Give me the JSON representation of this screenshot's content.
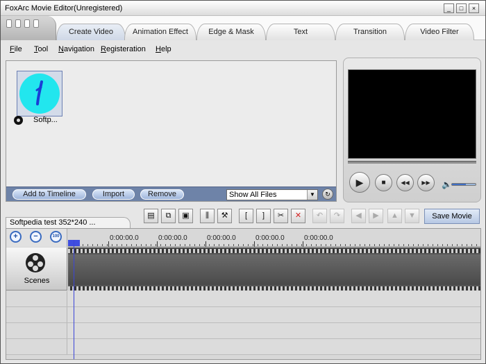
{
  "window": {
    "title": "FoxArc Movie Editor(Unregistered)",
    "minimize": "_",
    "maximize": "□",
    "close": "×"
  },
  "tabs": [
    {
      "label": "Create Video",
      "active": true
    },
    {
      "label": "Animation Effect",
      "active": false
    },
    {
      "label": "Edge & Mask",
      "active": false
    },
    {
      "label": "Text",
      "active": false
    },
    {
      "label": "Transition",
      "active": false
    },
    {
      "label": "Video Filter",
      "active": false
    }
  ],
  "menu": {
    "file": {
      "ul": "F",
      "rest": "ile"
    },
    "tool": {
      "ul": "T",
      "rest": "ool"
    },
    "navigation": {
      "ul": "N",
      "rest": "avigation"
    },
    "registeration": {
      "ul": "R",
      "rest": "egisteration"
    },
    "help": {
      "ul": "H",
      "rest": "elp"
    }
  },
  "library": {
    "items": [
      {
        "label": "Softp..."
      }
    ],
    "add_to_timeline": "Add to Timeline",
    "import": "Import",
    "remove": "Remove",
    "filter_selected": "Show All Files"
  },
  "player": {
    "play": "▶",
    "stop": "■",
    "rewind": "◀◀",
    "forward": "▶▶",
    "speaker": "🔈",
    "volume_level": 0.6
  },
  "timeline_toolbar": {
    "mark_in": "[",
    "mark_out": "]",
    "cut": "✂",
    "delete": "✕",
    "save_movie": "Save Movie"
  },
  "project": {
    "tab_label": "Softpedia test 352*240 ..."
  },
  "timeline": {
    "zoom_in": "+",
    "zoom_out": "−",
    "zoom_fit": "100",
    "ruler_labels": [
      "0:00:00.0",
      "0:00:00.0",
      "0:00:00.0",
      "0:00:00.0",
      "0:00:00.0"
    ],
    "scenes_label": "Scenes"
  },
  "colors": {
    "accent_blue": "#6e83a8",
    "thumb_cyan": "#22e6ee",
    "playhead": "#3b45d8",
    "delete_red": "#d42020"
  }
}
